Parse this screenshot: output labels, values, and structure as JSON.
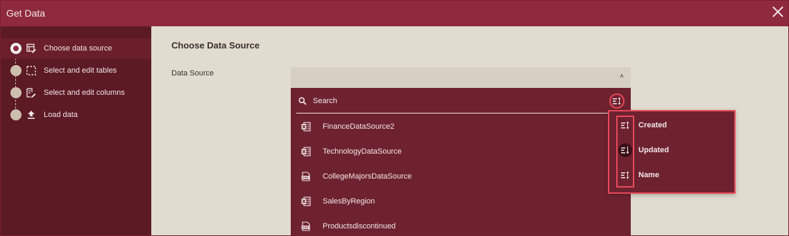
{
  "window": {
    "title": "Get Data"
  },
  "sidebar": {
    "steps": [
      {
        "label": "Choose data source",
        "icon": "table-edit-icon",
        "active": true
      },
      {
        "label": "Select and edit tables",
        "icon": "dashed-select-icon",
        "active": false
      },
      {
        "label": "Select and edit columns",
        "icon": "column-edit-icon",
        "active": false
      },
      {
        "label": "Load data",
        "icon": "upload-icon",
        "active": false
      }
    ]
  },
  "main": {
    "title": "Choose Data Source",
    "data_source_label": "Data Source",
    "select": {
      "caret": "˄"
    },
    "search": {
      "placeholder": "Search"
    },
    "items": [
      {
        "label": "FinanceDataSource2",
        "icon": "excel-file-icon"
      },
      {
        "label": "TechnologyDataSource",
        "icon": "excel-file-icon"
      },
      {
        "label": "CollegeMajorsDataSource",
        "icon": "csv-file-icon"
      },
      {
        "label": "SalesByRegion",
        "icon": "excel-file-icon"
      },
      {
        "label": "Productsdiscontinued",
        "icon": "csv-file-icon"
      }
    ]
  },
  "sort_menu": {
    "options": [
      {
        "label": "Created",
        "icon": "sort-icon",
        "selected": false
      },
      {
        "label": "Updated",
        "icon": "sort-descending-icon",
        "selected": true
      },
      {
        "label": "Name",
        "icon": "sort-icon",
        "selected": false
      }
    ]
  },
  "colors": {
    "titlebar": "#8f2a3e",
    "sidebar": "#5c1a24",
    "dropdown": "#6e2230",
    "highlight": "#e84a5a",
    "background": "#e0dccf"
  }
}
